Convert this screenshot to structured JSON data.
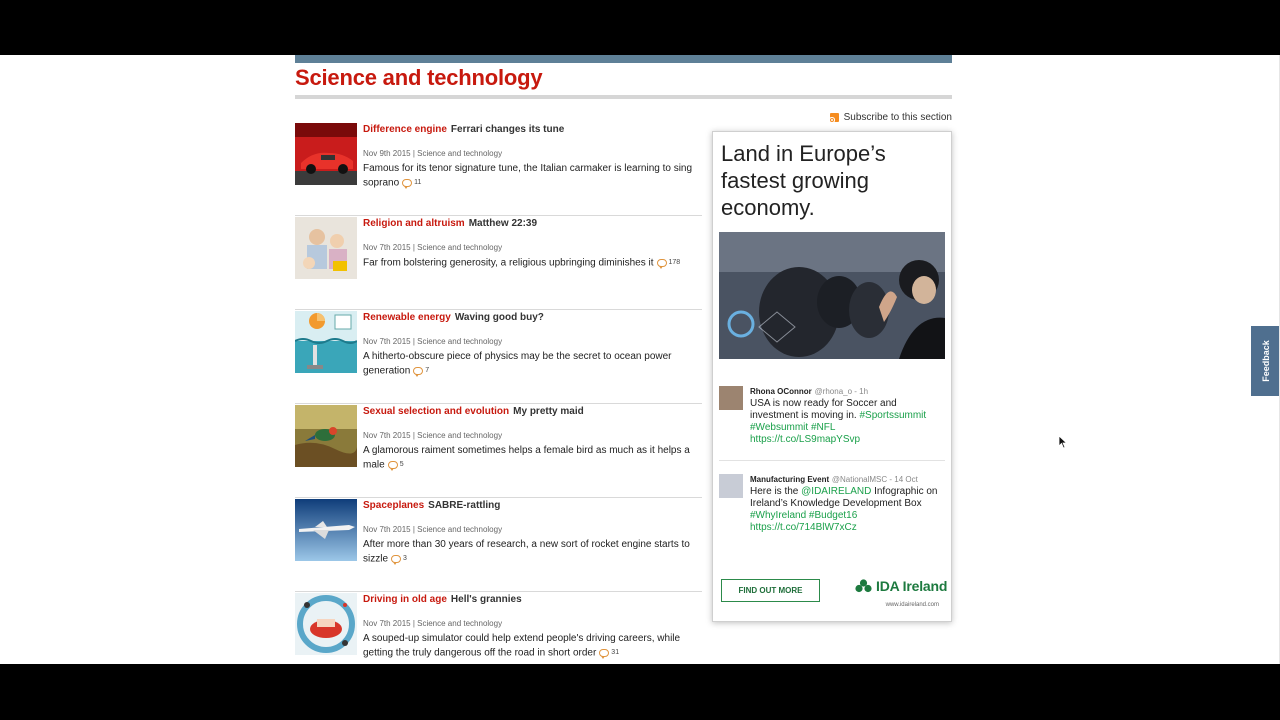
{
  "section": {
    "title": "Science and technology",
    "subscribe_label": "Subscribe to this section"
  },
  "articles": [
    {
      "fly_title": "Difference engine",
      "headline": "Ferrari changes its tune",
      "meta": "Nov 9th 2015 | Science and technology",
      "description": "Famous for its tenor signature tune, the Italian carmaker is learning to sing soprano",
      "comments": "11"
    },
    {
      "fly_title": "Religion and altruism",
      "headline": "Matthew 22:39",
      "meta": "Nov 7th 2015 | Science and technology",
      "description": "Far from bolstering generosity, a religious upbringing diminishes it",
      "comments": "178"
    },
    {
      "fly_title": "Renewable energy",
      "headline": "Waving good buy?",
      "meta": "Nov 7th 2015 | Science and technology",
      "description": "A hitherto-obscure piece of physics may be the secret to ocean power generation",
      "comments": "7"
    },
    {
      "fly_title": "Sexual selection and evolution",
      "headline": "My pretty maid",
      "meta": "Nov 7th 2015 | Science and technology",
      "description": "A glamorous raiment sometimes helps a female bird as much as it helps a male",
      "comments": "5"
    },
    {
      "fly_title": "Spaceplanes",
      "headline": "SABRE-rattling",
      "meta": "Nov 7th 2015 | Science and technology",
      "description": "After more than 30 years of research, a new sort of rocket engine starts to sizzle",
      "comments": "3"
    },
    {
      "fly_title": "Driving in old age",
      "headline": "Hell's grannies",
      "meta": "Nov 7th 2015 | Science and technology",
      "description": "A souped-up simulator could help extend people's driving careers, while getting the truly dangerous off the road in short order",
      "comments": "31"
    }
  ],
  "ad": {
    "headline": "Land in Europe’s fastest growing economy.",
    "tweets": [
      {
        "name": "Rhona OConnor",
        "handle": "@rhona_o - 1h",
        "text_plain": "USA is now ready for Soccer and investment is moving in.",
        "tags": "#Sportssummit #Websummit #NFL",
        "link": "https://t.co/LS9mapYSvp"
      },
      {
        "name": "Manufacturing Event",
        "handle": "@NationalMSC - 14 Oct",
        "text_pre": "Here is the ",
        "mention": "@IDAIRELAND",
        "text_post": " Infographic on Ireland’s Knowledge Development Box ",
        "tags": "#WhyIreland #Budget16",
        "link": "https://t.co/714BlW7xCz"
      }
    ],
    "cta_label": "FIND OUT MORE",
    "brand_name": "IDA Ireland",
    "brand_url": "www.idaireland.com"
  },
  "feedback_label": "Feedback",
  "colors": {
    "accent_red": "#c7190e",
    "header_bar": "#5e8097",
    "brand_green": "#1d7a3f",
    "tag_green": "#1aa04a",
    "feedback_tab": "#4f6f8f"
  }
}
